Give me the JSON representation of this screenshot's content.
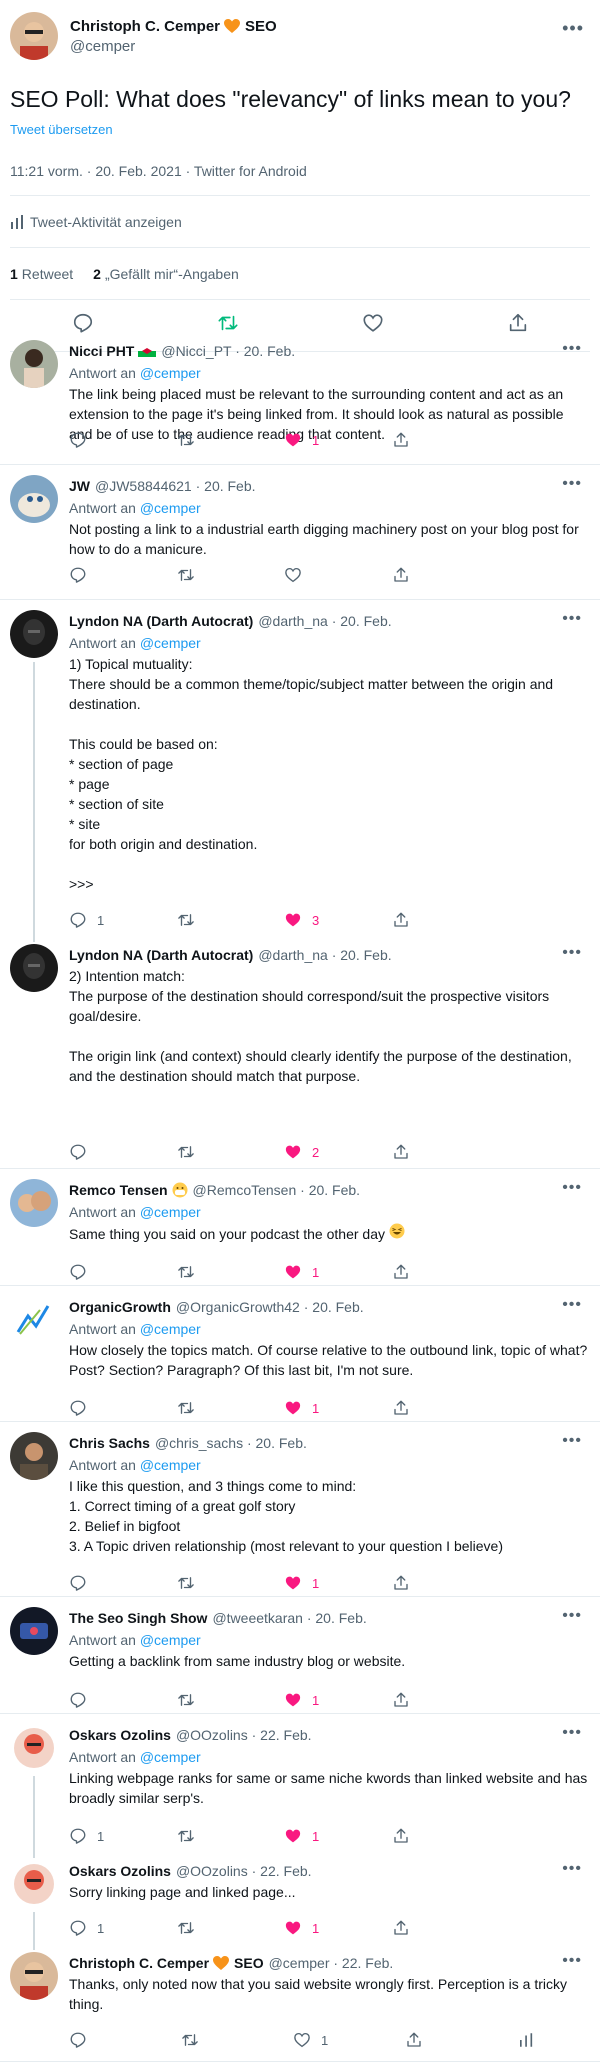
{
  "main_tweet": {
    "author_name": "Christoph C. Cemper",
    "author_suffix": "SEO",
    "handle": "@cemper",
    "text": "SEO Poll: What does \"relevancy\" of links mean to you?",
    "translate": "Tweet übersetzen",
    "meta": "11:21 vorm. · 20. Feb. 2021 · Twitter for Android",
    "activity": "Tweet-Aktivität anzeigen",
    "retweets_count": "1",
    "retweets_label": "Retweet",
    "likes_count": "2",
    "likes_label": "„Gefällt mir“-Angaben"
  },
  "reply_to_label": "Antwort an",
  "reply_to_mention": "@cemper",
  "replies": [
    {
      "name": "Nicci PHT",
      "handle": "@Nicci_PT · 20. Feb.",
      "reply_to": true,
      "text": "The link being placed must be relevant to the surrounding content and act as an extension to the page it's being linked from. It should look as natural as possible and be of use to the audience reading that content.",
      "reply_count": "",
      "like_count": "1",
      "liked": true
    },
    {
      "name": "JW",
      "handle": "@JW58844621 · 20. Feb.",
      "reply_to": true,
      "text": "Not posting a link to a industrial earth digging machinery post on your blog post for how to do a manicure.",
      "reply_count": "",
      "like_count": "",
      "liked": false
    },
    {
      "name": "Lyndon NA (Darth Autocrat)",
      "handle": "@darth_na · 20. Feb.",
      "reply_to": true,
      "text": "1) Topical mutuality:\nThere should be a common theme/topic/subject matter between the origin and destination.\n\nThis could be based on:\n* section of page\n* page\n* section of site\n* site\nfor both origin and destination.\n\n>>>",
      "reply_count": "1",
      "like_count": "3",
      "liked": true
    },
    {
      "name": "Lyndon NA (Darth Autocrat)",
      "handle": "@darth_na · 20. Feb.",
      "reply_to": false,
      "text": "2) Intention match:\nThe purpose of the destination should correspond/suit the prospective visitors goal/desire.\n\nThe origin link (and context) should clearly identify the purpose of the destination,\nand the destination should match that purpose.",
      "reply_count": "",
      "like_count": "2",
      "liked": true
    },
    {
      "name": "Remco Tensen",
      "handle": "@RemcoTensen · 20. Feb.",
      "reply_to": true,
      "text": "Same thing you said on your podcast the other day",
      "reply_count": "",
      "like_count": "1",
      "liked": true
    },
    {
      "name": "OrganicGrowth",
      "handle": "@OrganicGrowth42 · 20. Feb.",
      "reply_to": true,
      "text": "How closely the topics match. Of course relative to the outbound link, topic of what? Post? Section? Paragraph? Of this last bit, I'm not sure.",
      "reply_count": "",
      "like_count": "1",
      "liked": true
    },
    {
      "name": "Chris Sachs",
      "handle": "@chris_sachs · 20. Feb.",
      "reply_to": true,
      "text": "I like this question, and 3 things come to mind:\n1. Correct timing of a great golf story\n2. Belief in bigfoot\n3. A Topic driven relationship (most relevant to your question I believe)",
      "reply_count": "",
      "like_count": "1",
      "liked": true
    },
    {
      "name": "The Seo Singh Show",
      "handle": "@tweeetkaran · 20. Feb.",
      "reply_to": true,
      "text": "Getting a backlink from same industry blog or website.",
      "reply_count": "",
      "like_count": "1",
      "liked": true
    },
    {
      "name": "Oskars Ozolins",
      "handle": "@OOzolins · 22. Feb.",
      "reply_to": true,
      "text": "Linking webpage ranks for same or same niche kwords than linked website and has broadly similar serp's.",
      "reply_count": "1",
      "like_count": "1",
      "liked": true
    },
    {
      "name": "Oskars Ozolins",
      "handle": "@OOzolins · 22. Feb.",
      "reply_to": false,
      "text": "Sorry linking page and linked page...",
      "reply_count": "1",
      "like_count": "1",
      "liked": true
    },
    {
      "name": "Christoph C. Cemper",
      "name_suffix": "SEO",
      "handle": "@cemper · 22. Feb.",
      "reply_to": false,
      "text": "Thanks, only noted now that you said website wrongly first. Perception is a tricky thing.",
      "reply_count": "",
      "like_count": "1",
      "liked": false
    }
  ],
  "colors": {
    "accent": "#1d9bf0",
    "like": "#f91880",
    "retweet": "#00ba7c",
    "muted": "#536471"
  }
}
